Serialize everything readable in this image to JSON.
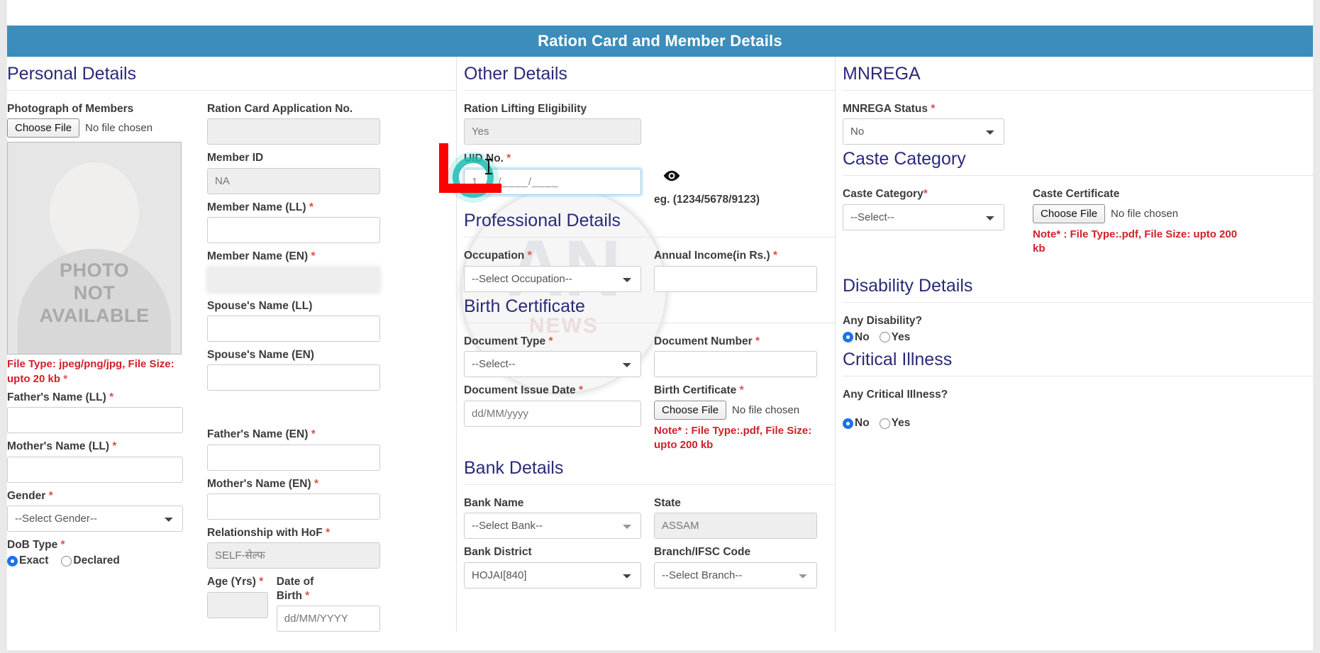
{
  "header": {
    "title": "Ration Card and Member Details"
  },
  "watermark": {
    "mark": "AN",
    "sub": "NEWS"
  },
  "personal": {
    "section_title": "Personal Details",
    "photo_label": "Photograph of Members",
    "choose_file": "Choose File",
    "no_file": "No file chosen",
    "photo_placeholder_line1": "PHOTO",
    "photo_placeholder_line2": "NOT",
    "photo_placeholder_line3": "AVAILABLE",
    "photo_note": "File Type: jpeg/png/jpg, File Size: upto 20 kb",
    "fathers_name_ll": "Father's Name (LL)",
    "mothers_name_ll": "Mother's Name (LL)",
    "gender_label": "Gender",
    "gender_value": "--Select Gender--",
    "dob_type_label": "DoB Type",
    "dob_exact": "Exact",
    "dob_declared": "Declared",
    "ration_card_app_no": "Ration Card Application No.",
    "ration_card_app_no_value": "",
    "member_id_label": "Member ID",
    "member_id_value": "NA",
    "member_name_ll": "Member Name (LL)",
    "member_name_en": "Member Name (EN)",
    "spouse_name_ll": "Spouse's Name (LL)",
    "spouse_name_en": "Spouse's Name (EN)",
    "fathers_name_en": "Father's Name (EN)",
    "mothers_name_en": "Mother's Name (EN)",
    "relationship_hof_label": "Relationship with HoF",
    "relationship_hof_value": "SELF-सेल्फ",
    "age_label": "Age (Yrs)",
    "age_value": "",
    "dob_label_line1": "Date of",
    "dob_label_line2": "Birth",
    "dob_placeholder": "dd/MM/YYYY"
  },
  "other": {
    "section_title": "Other Details",
    "ration_lifting_label": "Ration Lifting Eligibility",
    "ration_lifting_value": "Yes",
    "uid_label": "UID No.",
    "uid_value": "1___/____/____",
    "uid_eg": "eg. (1234/5678/9123)",
    "eye_icon": "eye-icon"
  },
  "professional": {
    "section_title": "Professional Details",
    "occupation_label": "Occupation",
    "occupation_value": "--Select Occupation--",
    "annual_income_label": "Annual Income(in Rs.)",
    "annual_income_value": ""
  },
  "birth_certificate": {
    "section_title": "Birth Certificate",
    "document_type_label": "Document Type",
    "document_type_value": "--Select--",
    "document_number_label": "Document Number",
    "document_number_value": "",
    "issue_date_label": "Document Issue Date",
    "issue_date_placeholder": "dd/MM/yyyy",
    "file_label": "Birth Certificate",
    "choose_file": "Choose File",
    "no_file": "No file chosen",
    "note": "Note* : File Type:.pdf, File Size: upto 200 kb"
  },
  "bank": {
    "section_title": "Bank Details",
    "bank_name_label": "Bank Name",
    "bank_name_value": "--Select Bank--",
    "state_label": "State",
    "state_value": "ASSAM",
    "bank_district_label": "Bank District",
    "bank_district_value": "HOJAI[840]",
    "branch_ifsc_label": "Branch/IFSC Code",
    "branch_ifsc_value": "--Select Branch--"
  },
  "mnrega": {
    "section_title": "MNREGA",
    "status_label": "MNREGA Status",
    "status_value": "No"
  },
  "caste": {
    "section_title": "Caste Category",
    "category_label": "Caste Category",
    "category_value": "--Select--",
    "certificate_label": "Caste Certificate",
    "choose_file": "Choose File",
    "no_file": "No file chosen",
    "note": "Note* : File Type:.pdf, File Size: upto 200 kb"
  },
  "disability": {
    "section_title": "Disability Details",
    "question": "Any Disability?",
    "option_no": "No",
    "option_yes": "Yes",
    "selected": "No"
  },
  "critical": {
    "section_title": "Critical Illness",
    "question": "Any Critical IIlness?",
    "option_no": "No",
    "option_yes": "Yes",
    "selected": "No"
  },
  "colors": {
    "header_bg": "#3c8dbc",
    "section_heading": "#2a2a7a",
    "note_red": "#d0202a",
    "annotation_red": "#ff0000",
    "highlight_teal": "#1abcb0",
    "radio_blue": "#1a73e8"
  }
}
